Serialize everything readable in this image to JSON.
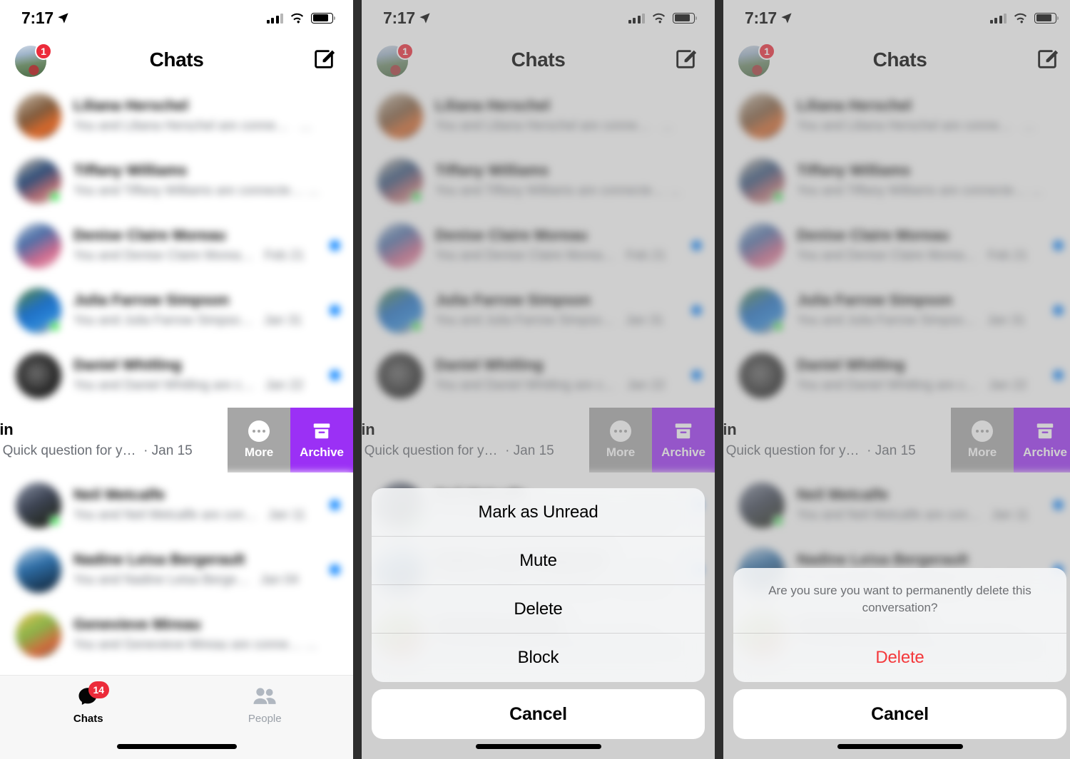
{
  "status_bar": {
    "time": "7:17",
    "location_icon": "location-arrow-icon",
    "signal_icon": "cellular-bars-icon",
    "wifi_icon": "wifi-icon",
    "battery_icon": "battery-icon"
  },
  "nav": {
    "title": "Chats",
    "avatar_badge": "1",
    "compose_icon": "compose-icon",
    "avatar_name": "profile-avatar"
  },
  "chat_list": [
    {
      "name": "Liliana Herschel",
      "preview": "You and Liliana Herschel are conne…",
      "time": "Mar 18",
      "unread": false,
      "online": false
    },
    {
      "name": "Tiffany Williams",
      "preview": "You and Tiffany Williams are connecte…",
      "time": "Mar 2",
      "unread": false,
      "online": true
    },
    {
      "name": "Denise Claire Moreau",
      "preview": "You and Denise Claire Morea…",
      "time": "Feb 21",
      "unread": true,
      "online": false
    },
    {
      "name": "Julia Farrow Simpson",
      "preview": "You and Julia Farrow Simpso…",
      "time": "Jan 31",
      "unread": true,
      "online": true
    },
    {
      "name": "Daniel Whitling",
      "preview": "You and Daniel Whitling are c…",
      "time": "Jan 22",
      "unread": true,
      "online": false
    }
  ],
  "chat_list_lower": [
    {
      "name": "Neil Metcalfe",
      "preview": "You and Neil Metcalfe are con…",
      "time": "Jan 11",
      "unread": true,
      "online": true
    },
    {
      "name": "Nadine Leisa Bergerault",
      "preview": "You and Nadine Leisa Berge…",
      "time": "Jan 04",
      "unread": true,
      "online": false
    },
    {
      "name": "Genevieve Mireau",
      "preview": "You and Genevieve Mireau are conne…",
      "time": "Dec 28",
      "unread": false,
      "online": false
    }
  ],
  "swiped_row": {
    "name_visible": "a Griffin",
    "preview_visible": "e Elise! Quick question for y…",
    "time": "· Jan 15",
    "actions": [
      {
        "label": "More",
        "icon": "ellipsis-circle-icon",
        "color": "#a6a6a6"
      },
      {
        "label": "Archive",
        "icon": "archive-box-icon",
        "color": "#9b30f5"
      }
    ]
  },
  "tab_bar": {
    "tabs": [
      {
        "label": "Chats",
        "icon": "chat-bubble-icon",
        "badge": "14",
        "active": true
      },
      {
        "label": "People",
        "icon": "people-icon",
        "badge": "",
        "active": false
      }
    ]
  },
  "action_sheet": {
    "items": [
      {
        "label": "Mark as Unread",
        "style": "default"
      },
      {
        "label": "Mute",
        "style": "default"
      },
      {
        "label": "Delete",
        "style": "default"
      },
      {
        "label": "Block",
        "style": "default"
      }
    ],
    "cancel_label": "Cancel"
  },
  "confirm_sheet": {
    "message": "Are you sure you want to permanently delete this conversation?",
    "confirm_label": "Delete",
    "cancel_label": "Cancel"
  },
  "colors": {
    "archive_purple": "#9b30f5",
    "more_gray": "#a6a6a6",
    "unread_blue": "#0a84ff",
    "badge_red": "#ec2b3a",
    "destructive_red": "#f4383b",
    "online_green": "#3ae24f"
  }
}
